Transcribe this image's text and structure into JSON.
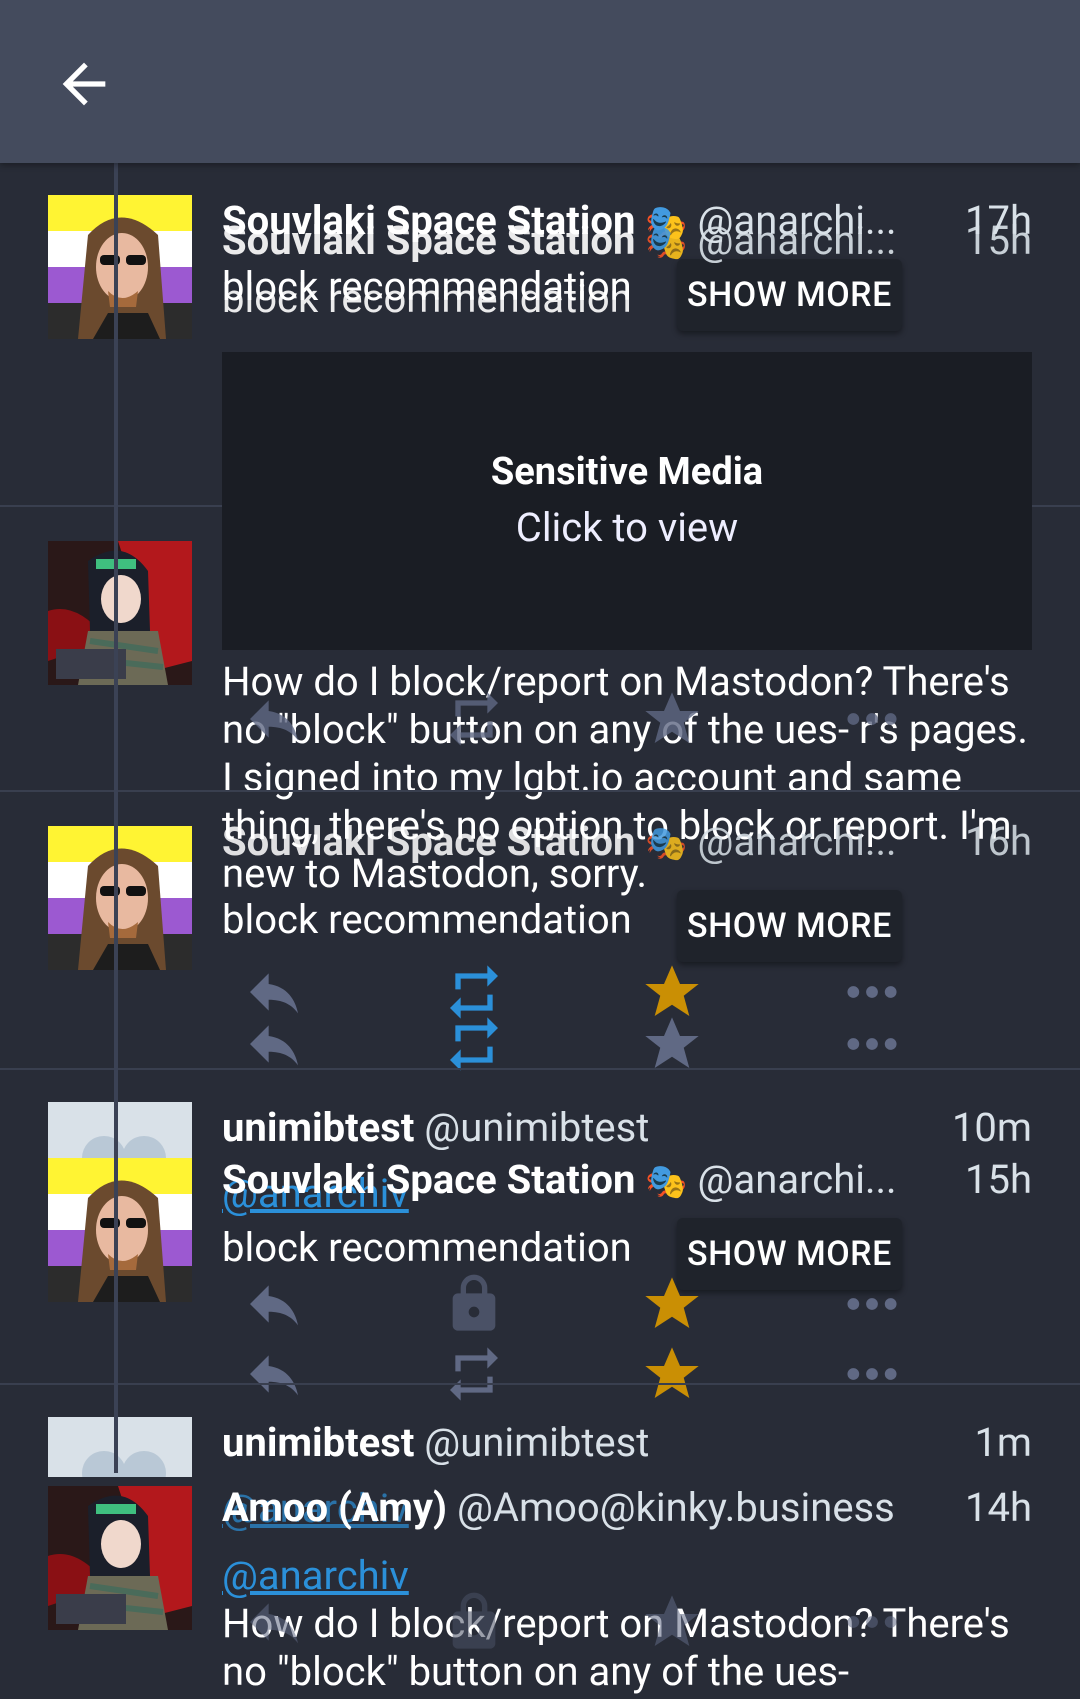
{
  "header": {
    "back": "arrow-left-icon"
  },
  "colors": {
    "accent": "#2b90d9",
    "favourite": "#ca8f04",
    "icon": "#606984",
    "background": "#282c37",
    "appbar": "#444b5d"
  },
  "sensitive": {
    "title": "Sensitive Media",
    "subtitle": "Click to view"
  },
  "statuses": [
    {
      "name": "Souvlaki Space Station",
      "handle": "@anarchi...",
      "time": "17h",
      "cw": "block recommendation",
      "show_more": "SHOW MORE"
    },
    {
      "name": "Souvlaki Space Station",
      "handle": "@anarchi...",
      "time": "15h",
      "cw": "block recommendation"
    },
    {
      "name": "Amoo (Amy)",
      "handle": "@Amoo@kinky.business",
      "time": "14h",
      "mention": "@anarchiv",
      "text": "How do I block/report on Mastodon? There's no \"block\" button on any of the ues- r's pages. I signed into my lgbt.io account and same thing, there's no option to block or report. I'm new to Mastodon, sorry."
    },
    {
      "name": "Souvlaki Space Station",
      "handle": "@anarchi...",
      "time": "16h",
      "cw": "block recommendation",
      "show_more": "SHOW MORE"
    },
    {
      "name": "unimibtest",
      "handle": "@unimibtest",
      "time": "10m",
      "mention": "@anarchiv"
    },
    {
      "name": "Souvlaki Space Station",
      "handle": "@anarchi...",
      "time": "15h",
      "cw": "block recommendation",
      "show_more": "SHOW MORE"
    },
    {
      "name": "unimibtest",
      "handle": "@unimibtest",
      "time": "1m",
      "mention": "@anarchiv"
    },
    {
      "name": "Amoo (Amy)",
      "handle": "@Amoo@kinky.business",
      "time": "14h",
      "mention": "@anarchiv",
      "text": "How do I block/report on Mastodon? There's no \"block\" button on any of the ues-"
    }
  ]
}
